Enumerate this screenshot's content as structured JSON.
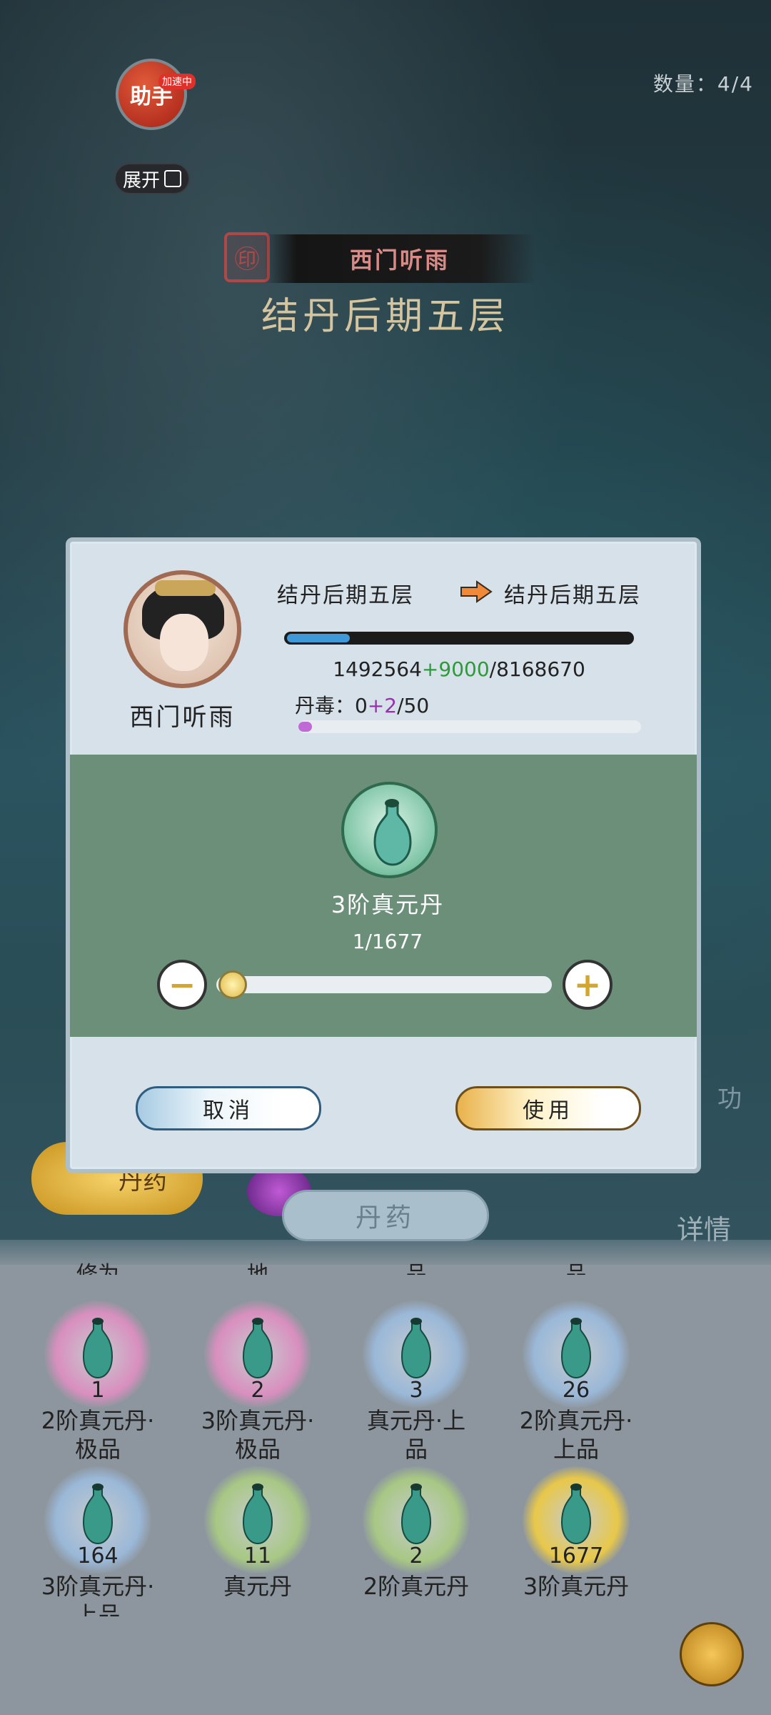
{
  "hud": {
    "assistant_label": "助手",
    "boost_badge": "加速中",
    "expand_label": "展开",
    "count": "数量：4/4"
  },
  "character": {
    "name": "西门听雨",
    "realm": "结丹后期五层"
  },
  "dialog": {
    "avatar_name": "西门听雨",
    "realm_from": "结丹后期五层",
    "realm_to": "结丹后期五层",
    "exp_current": "1492564",
    "exp_gain": "+9000",
    "exp_max": "/8168670",
    "exp_fraction": 0.183,
    "poison_label": "丹毒：",
    "poison_current": "0",
    "poison_gain": "+2",
    "poison_max": "/50",
    "poison_fraction": 0.04,
    "pill_name": "3阶真元丹",
    "pill_qty": "1/1677",
    "minus": "−",
    "plus": "+",
    "cancel_label": "取消",
    "use_label": "使用"
  },
  "background": {
    "alchemy_label": "丹药",
    "tab_label": "丹药",
    "detail_label": "详情",
    "skill_label": "功"
  },
  "inventory": {
    "top_cut": [
      "修为",
      "地",
      "品",
      "品"
    ],
    "items": [
      {
        "count": "1",
        "name_lines": [
          "2阶真元丹·",
          "极品"
        ],
        "orb": "#d98fbf"
      },
      {
        "count": "2",
        "name_lines": [
          "3阶真元丹·",
          "极品"
        ],
        "orb": "#d98fbf"
      },
      {
        "count": "3",
        "name_lines": [
          "真元丹·上",
          "品"
        ],
        "orb": "#9ab8d8"
      },
      {
        "count": "26",
        "name_lines": [
          "2阶真元丹·",
          "上品"
        ],
        "orb": "#9ab8d8"
      },
      {
        "count": "164",
        "name_lines": [
          "3阶真元丹·",
          "上品"
        ],
        "orb": "#9ab8d8"
      },
      {
        "count": "11",
        "name_lines": [
          "真元丹"
        ],
        "orb": "#a8c884"
      },
      {
        "count": "2",
        "name_lines": [
          "2阶真元丹"
        ],
        "orb": "#a8c884"
      },
      {
        "count": "1677",
        "name_lines": [
          "3阶真元丹"
        ],
        "orb": "#e8c84a"
      }
    ]
  },
  "colors": {
    "exp_gain": "#2f9a3a",
    "poison_gain": "#9b2fb0",
    "green_panel": "#6b8f79"
  }
}
